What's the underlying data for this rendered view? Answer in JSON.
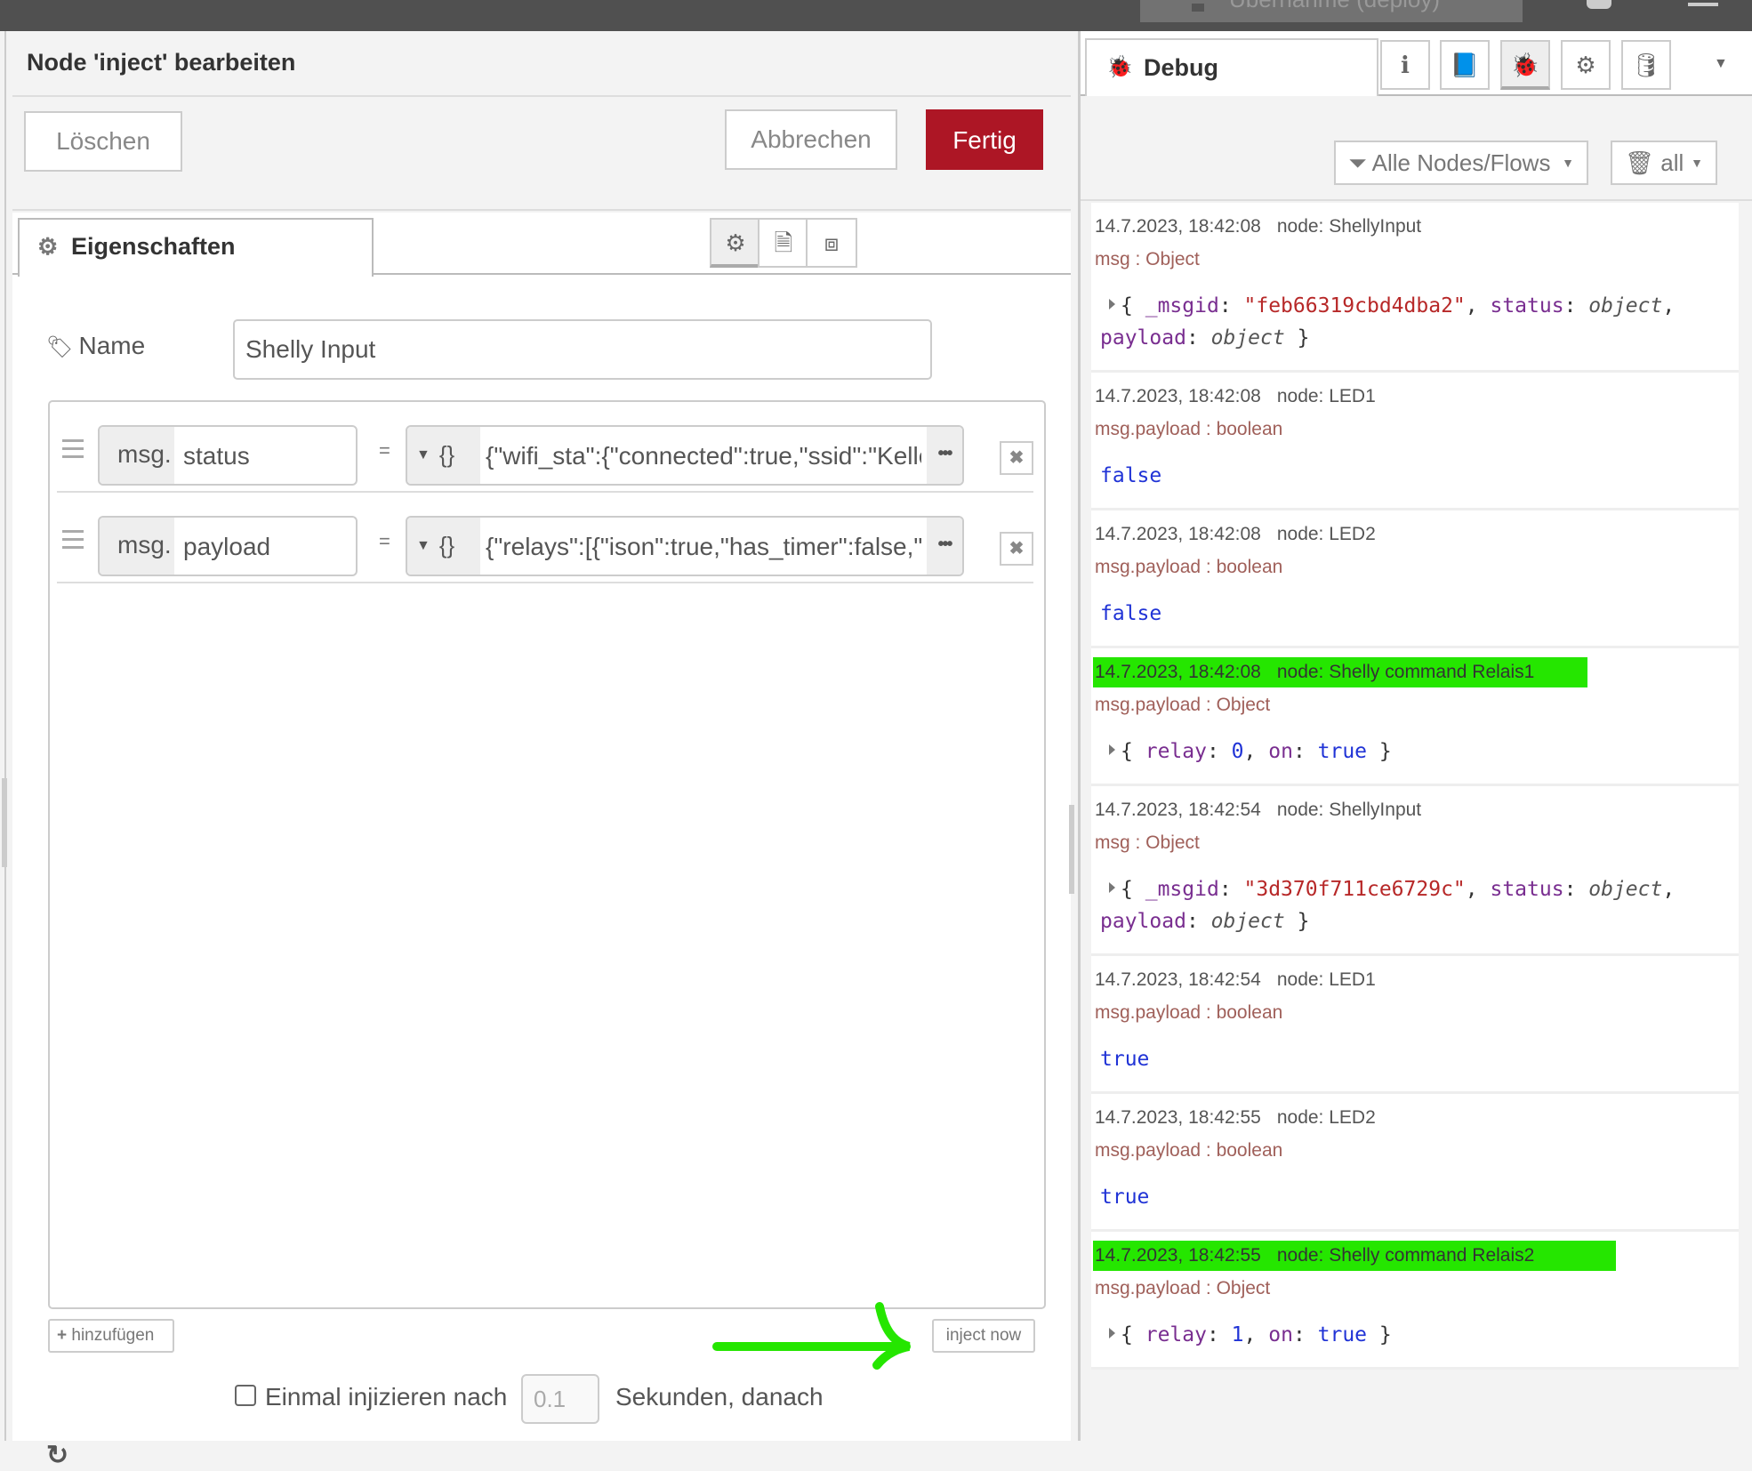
{
  "topbar": {
    "deploy_label": "Übernahme (deploy)"
  },
  "editor": {
    "title": "Node 'inject' bearbeiten",
    "delete_label": "Löschen",
    "cancel_label": "Abbrechen",
    "done_label": "Fertig",
    "done_color": "#ad1625",
    "tab_properties": "Eigenschaften",
    "name_label": "Name",
    "name_value": "Shelly Input",
    "properties": [
      {
        "prefix": "msg.",
        "key": "status",
        "type_icon": "{}",
        "value": "{\"wifi_sta\":{\"connected\":true,\"ssid\":\"Keller\"",
        "expand": "•••"
      },
      {
        "prefix": "msg.",
        "key": "payload",
        "type_icon": "{}",
        "value": "{\"relays\":[{\"ison\":true,\"has_timer\":false,\"ti",
        "expand": "•••"
      }
    ],
    "add_label": "hinzufügen",
    "inject_now_label": "inject now",
    "once_label": "Einmal injizieren nach",
    "once_delay": "0.1",
    "once_suffix": "Sekunden, danach",
    "annotation_color": "#25e600"
  },
  "sidebar": {
    "tab_debug": "Debug",
    "filter_label": "Alle Nodes/Flows",
    "clear_label": "all",
    "highlight_color": "#25e600",
    "messages": [
      {
        "time": "14.7.2023, 18:42:08",
        "node": "node: ShellyInput",
        "type": "msg : Object",
        "highlight": false
      },
      {
        "time": "14.7.2023, 18:42:08",
        "node": "node: LED1",
        "type": "msg.payload : boolean",
        "value": "false",
        "highlight": false
      },
      {
        "time": "14.7.2023, 18:42:08",
        "node": "node: LED2",
        "type": "msg.payload : boolean",
        "value": "false",
        "highlight": false
      },
      {
        "time": "14.7.2023, 18:42:08",
        "node": "node: Shelly command Relais1",
        "type": "msg.payload : Object",
        "highlight": true
      },
      {
        "time": "14.7.2023, 18:42:54",
        "node": "node: ShellyInput",
        "type": "msg : Object",
        "highlight": false
      },
      {
        "time": "14.7.2023, 18:42:54",
        "node": "node: LED1",
        "type": "msg.payload : boolean",
        "value": "true",
        "highlight": false
      },
      {
        "time": "14.7.2023, 18:42:55",
        "node": "node: LED2",
        "type": "msg.payload : boolean",
        "value": "true",
        "highlight": false
      },
      {
        "time": "14.7.2023, 18:42:55",
        "node": "node: Shelly command Relais2",
        "type": "msg.payload : Object",
        "highlight": true
      }
    ],
    "objects": {
      "m0": {
        "k1": "_msgid",
        "v1": "\"feb66319cbd4dba2\"",
        "k2": "status",
        "v2": "object",
        "k3": "payload",
        "v3": "object"
      },
      "m3": {
        "k1": "relay",
        "v1": "0",
        "k2": "on",
        "v2": "true"
      },
      "m4": {
        "k1": "_msgid",
        "v1": "\"3d370f711ce6729c\"",
        "k2": "status",
        "v2": "object",
        "k3": "payload",
        "v3": "object"
      },
      "m7": {
        "k1": "relay",
        "v1": "1",
        "k2": "on",
        "v2": "true"
      }
    }
  },
  "punct": {
    "open": "{",
    "close": "}",
    "colon": ": ",
    "comma": ", "
  }
}
